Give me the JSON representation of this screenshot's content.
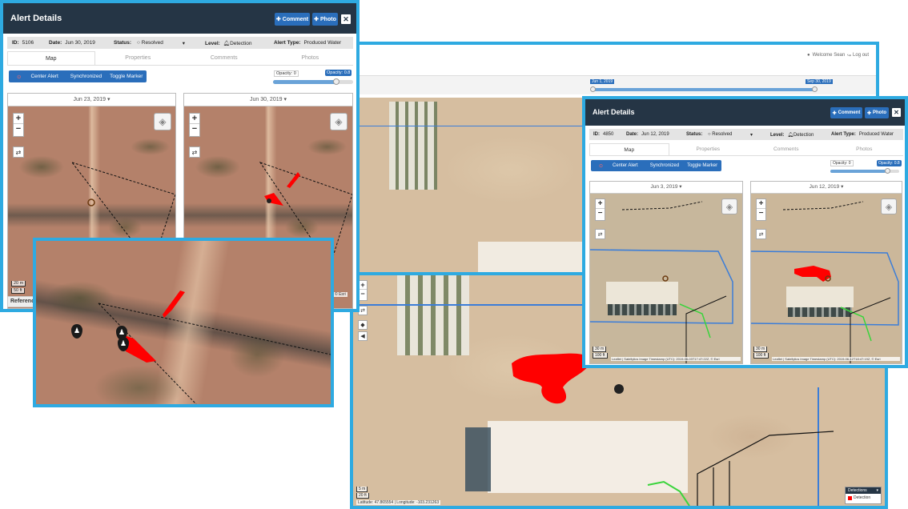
{
  "colors": {
    "accent": "#2eaae1",
    "header": "#253545",
    "button": "#2a6ebb",
    "detection": "#ff0000"
  },
  "background_app": {
    "welcome": "Welcome Sean",
    "logout": "Log out",
    "timeline_start": "Jun 1, 2019",
    "timeline_end": "Sep 30, 2019"
  },
  "panel_a": {
    "title": "Alert Details",
    "comment_btn": "Comment",
    "photo_btn": "Photo",
    "close": "✕",
    "id_label": "ID:",
    "id": "5106",
    "date_label": "Date:",
    "date": "Jun 30, 2019",
    "status_label": "Status:",
    "status": "Resolved",
    "level_label": "Level:",
    "level": "Detection",
    "alert_type_label": "Alert Type:",
    "alert_type": "Produced Water",
    "tabs": [
      "Map",
      "Properties",
      "Comments",
      "Photos"
    ],
    "toolbar": [
      "Center Alert",
      "Synchronized",
      "Toggle Marker"
    ],
    "opacity_label": "Opacity: 0",
    "opacity_badge": "Opacity: 0.8",
    "opacity_value": 0.8,
    "left_date": "Jun 23, 2019",
    "right_date": "Jun 30, 2019",
    "scale_m": "20 m",
    "scale_ft": "50 ft",
    "reference_label": "Referenc",
    "attribution": "© Esri"
  },
  "panel_b": {
    "title": "Alert Details",
    "comment_btn": "Comment",
    "photo_btn": "Photo",
    "close": "✕",
    "id_label": "ID:",
    "id": "4850",
    "date_label": "Date:",
    "date": "Jun 12, 2019",
    "status_label": "Status:",
    "status": "Resolved",
    "level_label": "Level:",
    "level": "Detection",
    "alert_type_label": "Alert Type:",
    "alert_type": "Produced Water",
    "tabs": [
      "Map",
      "Properties",
      "Comments",
      "Photos"
    ],
    "toolbar": [
      "Center Alert",
      "Synchronized",
      "Toggle Marker"
    ],
    "opacity_label": "Opacity: 0",
    "opacity_badge": "Opacity: 0.8",
    "opacity_value": 0.8,
    "left_date": "Jun 3, 2019",
    "right_date": "Jun 12, 2019",
    "scale_m": "30 m",
    "scale_ft": "100 ft",
    "left_attribution": "Leaflet | Satellytics Image Timestamp (UTC): 2019-06-03T17:47:22Z, © Esri",
    "right_attribution": "Leaflet | Satellytics Image Timestamp (UTC): 2019-06-12T18:47:19Z, © Esri"
  },
  "big_map": {
    "scale_m": "5 m",
    "scale_ft": "20 ft",
    "coords": "Latitude: 47.865554 | Longitude: -103.231263",
    "legend_title": "Detections",
    "legend_item": "Detection"
  }
}
